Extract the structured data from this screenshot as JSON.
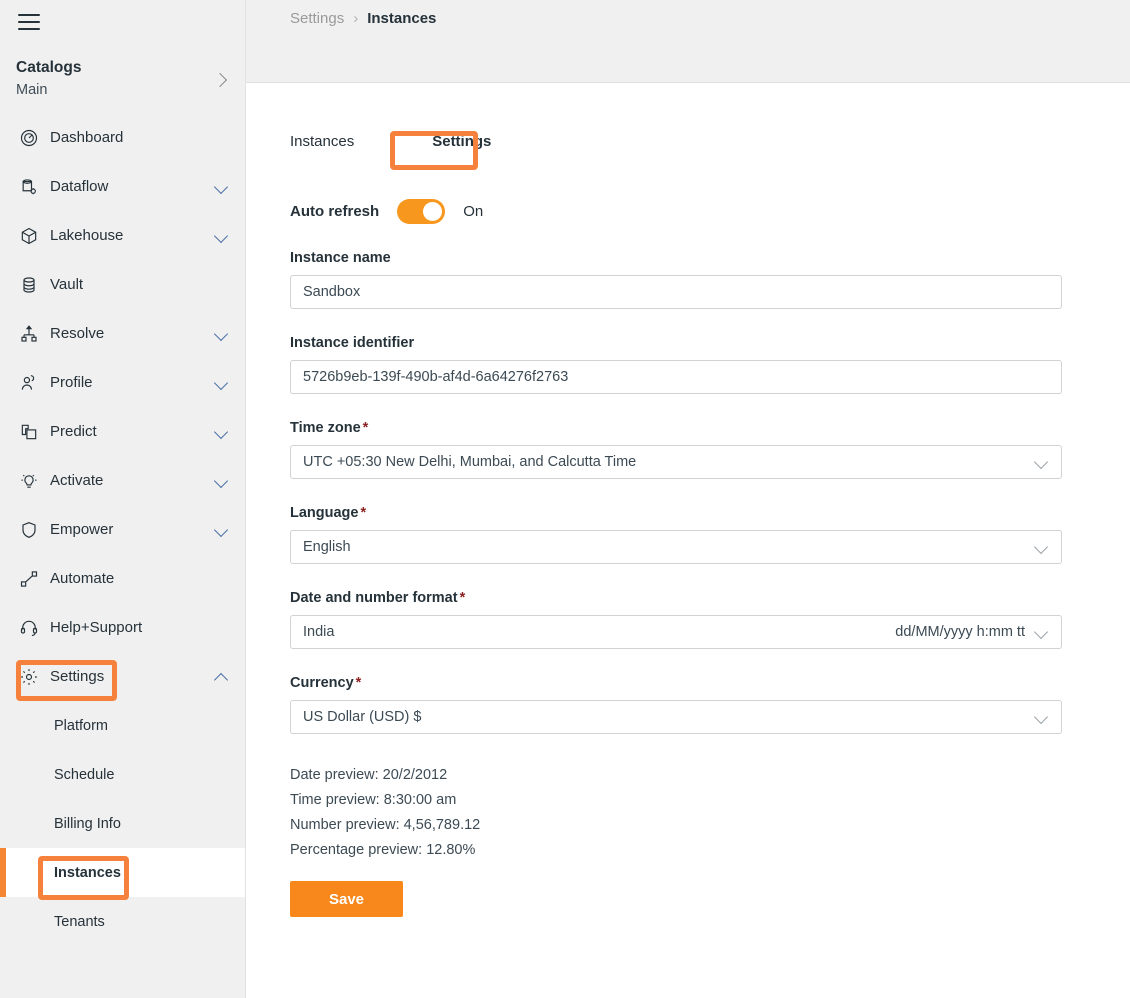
{
  "sidebar": {
    "menu_icon": "hamburger-icon",
    "catalogs": {
      "title": "Catalogs",
      "subtitle": "Main",
      "chevron": "chevron-right-icon"
    },
    "items": [
      {
        "label": "Dashboard",
        "icon": "gauge-icon",
        "expandable": false
      },
      {
        "label": "Dataflow",
        "icon": "database-gear-icon",
        "expandable": true
      },
      {
        "label": "Lakehouse",
        "icon": "cube-icon",
        "expandable": true
      },
      {
        "label": "Vault",
        "icon": "database-icon",
        "expandable": false
      },
      {
        "label": "Resolve",
        "icon": "hierarchy-icon",
        "expandable": true
      },
      {
        "label": "Profile",
        "icon": "person-icon",
        "expandable": true
      },
      {
        "label": "Predict",
        "icon": "layers-icon",
        "expandable": true
      },
      {
        "label": "Activate",
        "icon": "lightbulb-icon",
        "expandable": true
      },
      {
        "label": "Empower",
        "icon": "shield-icon",
        "expandable": true
      },
      {
        "label": "Automate",
        "icon": "nodes-icon",
        "expandable": false
      },
      {
        "label": "Help+Support",
        "icon": "headset-icon",
        "expandable": false
      },
      {
        "label": "Settings",
        "icon": "gear-icon",
        "expandable": true,
        "expanded": true
      }
    ],
    "settings_children": [
      {
        "label": "Platform",
        "active": false
      },
      {
        "label": "Schedule",
        "active": false
      },
      {
        "label": "Billing Info",
        "active": false
      },
      {
        "label": "Instances",
        "active": true
      },
      {
        "label": "Tenants",
        "active": false
      }
    ]
  },
  "breadcrumb": {
    "parent": "Settings",
    "separator": "›",
    "current": "Instances"
  },
  "tabs": [
    {
      "label": "Instances",
      "active": false
    },
    {
      "label": "Settings",
      "active": true
    }
  ],
  "auto_refresh": {
    "label": "Auto refresh",
    "state": "On",
    "enabled": true
  },
  "form": {
    "instance_name": {
      "label": "Instance name",
      "value": "Sandbox",
      "required": false
    },
    "instance_identifier": {
      "label": "Instance identifier",
      "value": "5726b9eb-139f-490b-af4d-6a64276f2763",
      "required": false
    },
    "time_zone": {
      "label": "Time zone",
      "required_mark": "*",
      "value": "UTC +05:30 New Delhi, Mumbai, and Calcutta Time"
    },
    "language": {
      "label": "Language",
      "required_mark": "*",
      "value": "English"
    },
    "date_number_format": {
      "label": "Date and number format",
      "required_mark": "*",
      "value": "India",
      "pattern": "dd/MM/yyyy  h:mm  tt"
    },
    "currency": {
      "label": "Currency",
      "required_mark": "*",
      "value": "US Dollar (USD) $"
    }
  },
  "previews": [
    "Date preview: 20/2/2012",
    "Time preview: 8:30:00 am",
    "Number preview: 4,56,789.12",
    "Percentage preview: 12.80%"
  ],
  "save_button": {
    "label": "Save"
  },
  "colors": {
    "accent_orange": "#f8871c",
    "toggle_orange": "#f8971d",
    "annotation_orange": "#f5813c",
    "sidebar_bg": "#f0f0f0",
    "required_red": "#8c1f1f",
    "text": "#26323a"
  }
}
